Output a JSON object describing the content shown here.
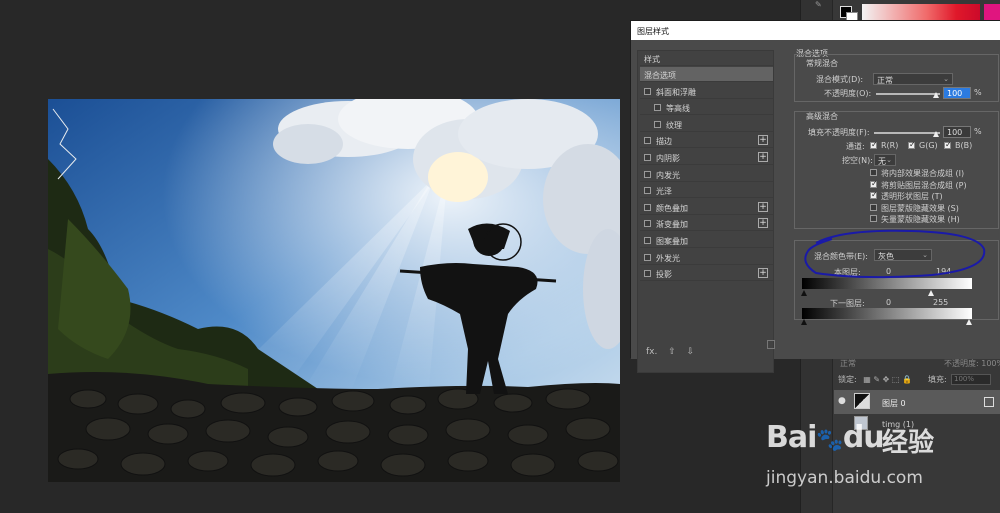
{
  "dialog": {
    "title": "图层样式",
    "styles_header": "样式",
    "styles": [
      {
        "label": "混合选项",
        "checkbox": false,
        "plus": false,
        "active": true,
        "sub": false
      },
      {
        "label": "斜面和浮雕",
        "checkbox": true,
        "plus": false,
        "active": false,
        "sub": false
      },
      {
        "label": "等高线",
        "checkbox": true,
        "plus": false,
        "active": false,
        "sub": true
      },
      {
        "label": "纹理",
        "checkbox": true,
        "plus": false,
        "active": false,
        "sub": true
      },
      {
        "label": "描边",
        "checkbox": true,
        "plus": true,
        "active": false,
        "sub": false
      },
      {
        "label": "内阴影",
        "checkbox": true,
        "plus": true,
        "active": false,
        "sub": false
      },
      {
        "label": "内发光",
        "checkbox": true,
        "plus": false,
        "active": false,
        "sub": false
      },
      {
        "label": "光泽",
        "checkbox": true,
        "plus": false,
        "active": false,
        "sub": false
      },
      {
        "label": "颜色叠加",
        "checkbox": true,
        "plus": true,
        "active": false,
        "sub": false
      },
      {
        "label": "渐变叠加",
        "checkbox": true,
        "plus": true,
        "active": false,
        "sub": false
      },
      {
        "label": "图案叠加",
        "checkbox": true,
        "plus": false,
        "active": false,
        "sub": false
      },
      {
        "label": "外发光",
        "checkbox": true,
        "plus": false,
        "active": false,
        "sub": false
      },
      {
        "label": "投影",
        "checkbox": true,
        "plus": true,
        "active": false,
        "sub": false
      }
    ],
    "footer_fx": "fx.",
    "blend_options_title": "混合选项",
    "general_blending": "常规混合",
    "blend_mode_label": "混合模式(D):",
    "blend_mode_value": "正常",
    "opacity_label": "不透明度(O):",
    "opacity_value": "100",
    "percent": "%",
    "advanced_blending": "高级混合",
    "fill_opacity_label": "填充不透明度(F):",
    "fill_opacity_value": "100",
    "channels_label": "通道:",
    "channel_r": "R(R)",
    "channel_g": "G(G)",
    "channel_b": "B(B)",
    "knockout_label": "挖空(N):",
    "knockout_value": "无",
    "adv_options": [
      {
        "label": "将内部效果混合成组 (I)",
        "checked": false
      },
      {
        "label": "将剪贴图层混合成组 (P)",
        "checked": true
      },
      {
        "label": "透明形状图层 (T)",
        "checked": true
      },
      {
        "label": "图层蒙版隐藏效果 (S)",
        "checked": false
      },
      {
        "label": "矢量蒙版隐藏效果 (H)",
        "checked": false
      }
    ],
    "blend_if_label": "混合颜色带(E):",
    "blend_if_value": "灰色",
    "this_layer_label": "本图层:",
    "this_layer_min": "0",
    "this_layer_max": "194",
    "this_layer_max_frac": 0.76,
    "underlying_label": "下一图层:",
    "underlying_min": "0",
    "underlying_max": "255",
    "annotation_color": "#1a1aa8"
  },
  "layers_panel": {
    "blend_mode": "正常",
    "opacity": "不透明度: 100%",
    "lock_label": "锁定:",
    "fill_label": "填充:",
    "fill_value": "100%",
    "layer0": "图层 0",
    "layer1": "timg (1)"
  },
  "watermark": {
    "brand": "Bai",
    "brand2": "du",
    "cn": "经验",
    "url": "jingyan.baidu.com"
  }
}
